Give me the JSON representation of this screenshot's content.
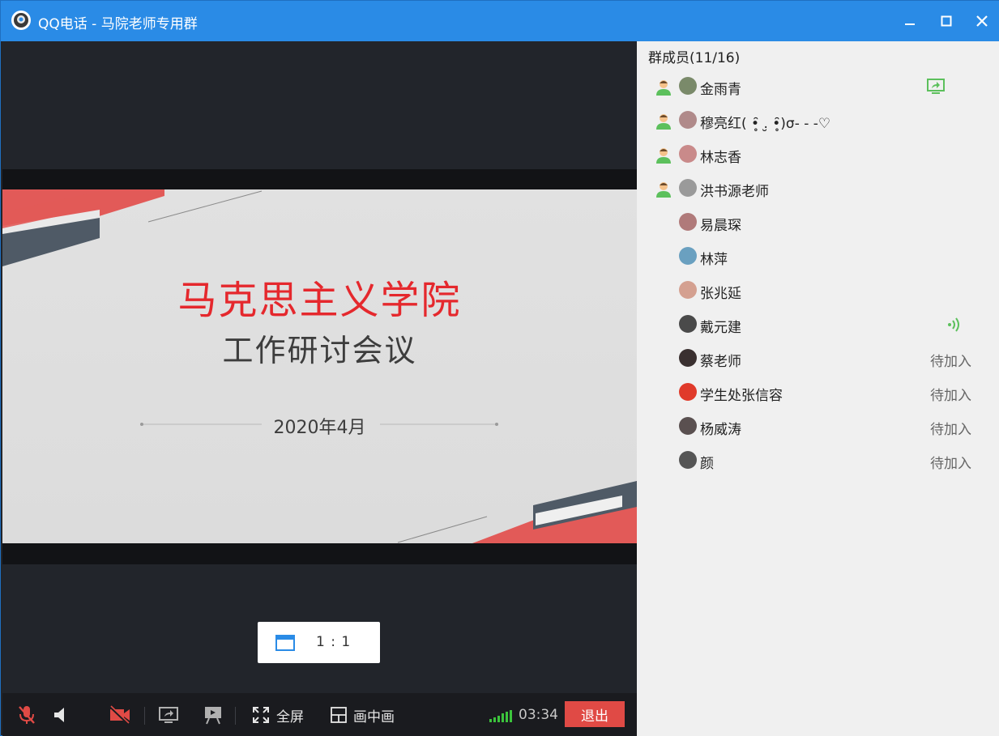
{
  "window": {
    "title": "QQ电话 - 马院老师专用群"
  },
  "slide": {
    "title": "马克思主义学院",
    "subtitle": "工作研讨会议",
    "date": "2020年4月"
  },
  "ratio_button": {
    "label": "1 : 1"
  },
  "toolbar": {
    "fullscreen_label": "全屏",
    "pip_label": "画中画",
    "timer": "03:34",
    "exit_label": "退出"
  },
  "members_panel": {
    "header": "群成员(11/16)",
    "members": [
      {
        "name": "金雨青",
        "host": true,
        "avatar_color": "#7a8a6a",
        "indicator": "screen-share"
      },
      {
        "name": "穆亮红( •̥̑ .̮ •̥̑)σ- - -♡",
        "host": true,
        "avatar_color": "#b08a8a",
        "indicator": ""
      },
      {
        "name": "林志香",
        "host": true,
        "avatar_color": "#c98a8a",
        "indicator": ""
      },
      {
        "name": "洪书源老师",
        "host": true,
        "avatar_color": "#9a9a9a",
        "indicator": ""
      },
      {
        "name": "易晨琛",
        "host": false,
        "avatar_color": "#b07a7a",
        "indicator": ""
      },
      {
        "name": "林萍",
        "host": false,
        "avatar_color": "#6aa0c0",
        "indicator": ""
      },
      {
        "name": "张兆延",
        "host": false,
        "avatar_color": "#d4a090",
        "indicator": ""
      },
      {
        "name": "戴元建",
        "host": false,
        "avatar_color": "#4a4a4a",
        "indicator": "speaking"
      },
      {
        "name": "蔡老师",
        "host": false,
        "avatar_color": "#3a3030",
        "indicator": "",
        "status": "待加入"
      },
      {
        "name": "学生处张信容",
        "host": false,
        "avatar_color": "#e03a2a",
        "indicator": "",
        "status": "待加入"
      },
      {
        "name": "杨威涛",
        "host": false,
        "avatar_color": "#5a5050",
        "indicator": "",
        "status": "待加入"
      },
      {
        "name": "颜",
        "host": false,
        "avatar_color": "#555555",
        "indicator": "",
        "status": "待加入"
      }
    ]
  },
  "colors": {
    "titlebar": "#2a8be6",
    "slide_accent": "#e5282d",
    "exit": "#e04a45",
    "online_green": "#5cc05c"
  }
}
